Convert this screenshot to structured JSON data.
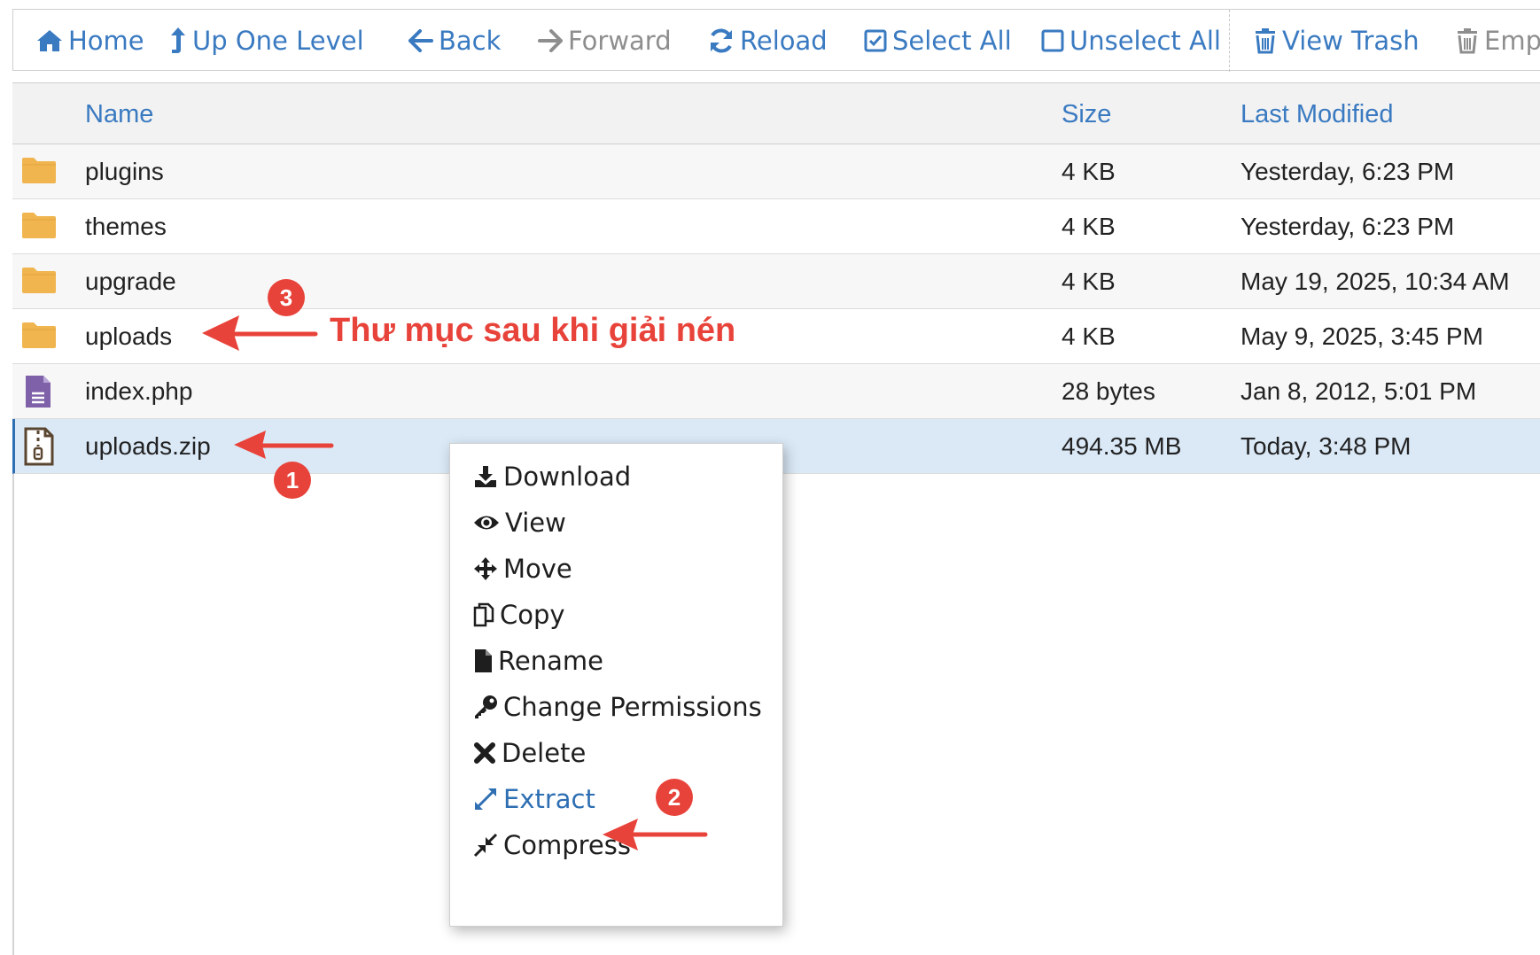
{
  "toolbar": {
    "home": "Home",
    "up_one_level": "Up One Level",
    "back": "Back",
    "forward": "Forward",
    "reload": "Reload",
    "select_all": "Select All",
    "unselect_all": "Unselect All",
    "view_trash": "View Trash",
    "empty_trash": "Empt"
  },
  "table": {
    "headers": {
      "name": "Name",
      "size": "Size",
      "modified": "Last Modified"
    },
    "rows": [
      {
        "type": "folder",
        "name": "plugins",
        "size": "4 KB",
        "modified": "Yesterday, 6:23 PM"
      },
      {
        "type": "folder",
        "name": "themes",
        "size": "4 KB",
        "modified": "Yesterday, 6:23 PM"
      },
      {
        "type": "folder",
        "name": "upgrade",
        "size": "4 KB",
        "modified": "May 19, 2025, 10:34 AM"
      },
      {
        "type": "folder",
        "name": "uploads",
        "size": "4 KB",
        "modified": "May 9, 2025, 3:45 PM"
      },
      {
        "type": "text-file",
        "name": "index.php",
        "size": "28 bytes",
        "modified": "Jan 8, 2012, 5:01 PM"
      },
      {
        "type": "zip-file",
        "name": "uploads.zip",
        "size": "494.35 MB",
        "modified": "Today, 3:48 PM",
        "selected": true
      }
    ]
  },
  "context_menu": {
    "items": [
      "Download",
      "View",
      "Move",
      "Copy",
      "Rename",
      "Change Permissions",
      "Delete",
      "Extract",
      "Compress"
    ],
    "highlighted": "Extract"
  },
  "annotations": {
    "badge_1": "1",
    "badge_2": "2",
    "badge_3": "3",
    "note": "Thư mục sau khi giải nén"
  },
  "colors": {
    "link_blue": "#3a7ac1",
    "annotation_red": "#e8433a",
    "folder_yellow": "#f0b54f",
    "selected_row": "#dbe9f7"
  }
}
